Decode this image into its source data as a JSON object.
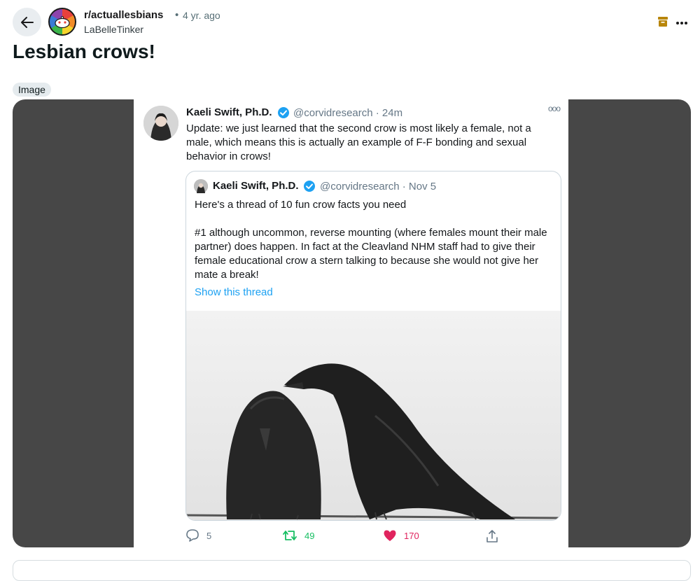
{
  "post": {
    "subreddit": "r/actuallesbians",
    "separator": "•",
    "age": "4 yr. ago",
    "author": "LaBelleTinker",
    "title": "Lesbian crows!",
    "flair": "Image"
  },
  "icons": {
    "back": "arrow-left-icon",
    "archive": "archive-icon",
    "more": "more-horizontal-icon"
  },
  "tweet": {
    "name": "Kaeli Swift, Ph.D.",
    "handle_time": "@corvidresearch · 24m",
    "more": "ooo",
    "text": "Update: we just learned that the second crow is most likely a female, not a male, which means this is actually an example of F-F bonding and sexual behavior in crows!",
    "quoted": {
      "name": "Kaeli Swift, Ph.D.",
      "handle_time": "@corvidresearch · Nov 5",
      "line1": "Here's a thread of 10 fun crow facts you need",
      "line2": "#1 although uncommon, reverse mounting (where females mount their male partner) does happen. In fact at the Cleavland NHM staff had to give their female educational crow a stern talking to because she would not give her mate a break!",
      "link": "Show this thread"
    },
    "replies": "5",
    "retweets": "49",
    "likes": "170"
  },
  "colors": {
    "verified": "#1da1f2",
    "retweet": "#17bf63",
    "like": "#e0245e",
    "archive": "#b8860b"
  }
}
